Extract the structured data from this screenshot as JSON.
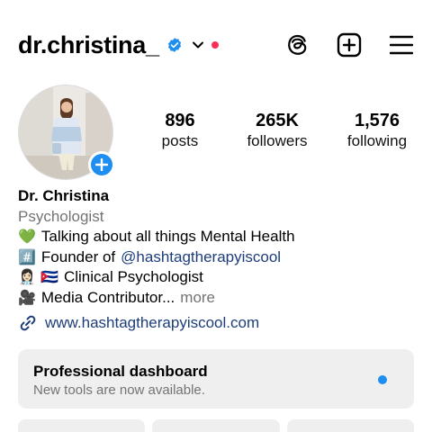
{
  "header": {
    "username": "dr.christina_",
    "verified_icon": "verified-badge-icon",
    "accent": "#1e8ef0",
    "notification_color": "#ff2d55"
  },
  "stats": [
    {
      "value": "896",
      "label": "posts"
    },
    {
      "value": "265K",
      "label": "followers"
    },
    {
      "value": "1,576",
      "label": "following"
    }
  ],
  "bio": {
    "name": "Dr. Christina",
    "category": "Psychologist",
    "line1_emoji": "💚",
    "line1_text": "Talking about all things Mental Health",
    "line2_emoji": "#️⃣",
    "line2_prefix": "Founder of",
    "line2_mention": "@hashtagtherapyiscool",
    "line3_emoji": "👩🏻‍⚕️ 🇨🇺",
    "line3_text": "Clinical Psychologist",
    "line4_emoji": "🎥",
    "line4_text": "Media Contributor...",
    "more_label": "more"
  },
  "link": {
    "text": "www.hashtagtherapyiscool.com"
  },
  "dashboard": {
    "title": "Professional dashboard",
    "subtitle": "New tools are now available."
  }
}
